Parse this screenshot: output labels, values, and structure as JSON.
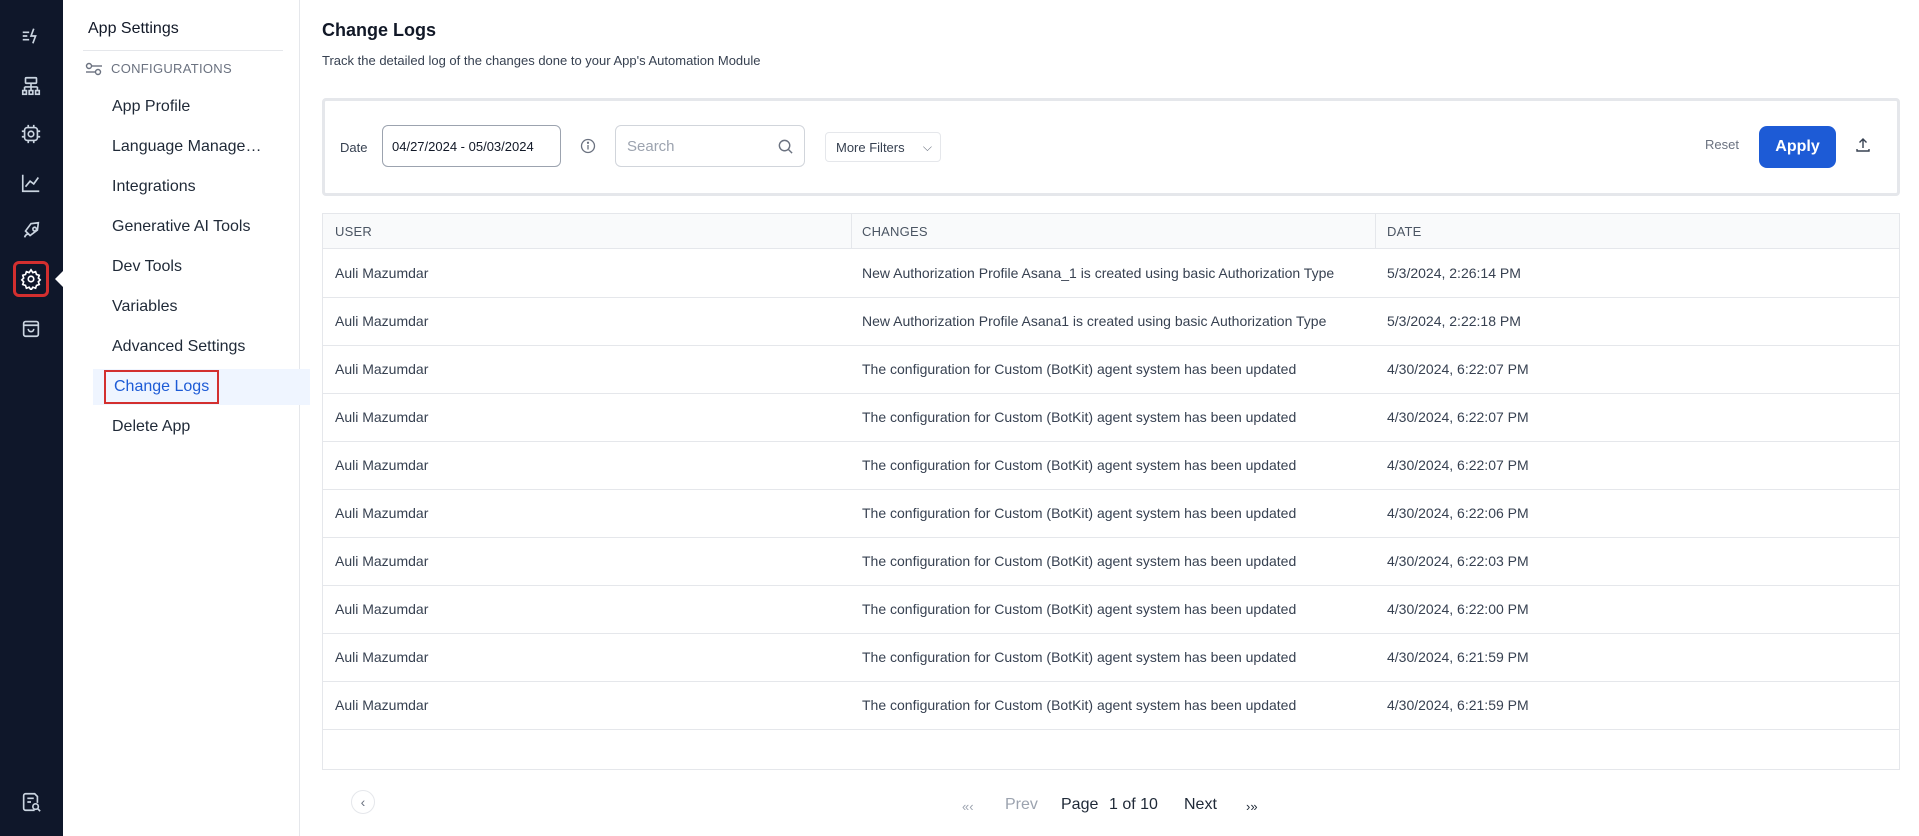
{
  "rail": {
    "icons": [
      "automation-icon",
      "flow-icon",
      "chip-icon",
      "analytics-icon",
      "rocket-icon",
      "gear-icon",
      "bag-icon",
      "help-doc-icon"
    ]
  },
  "sidebar": {
    "title": "App Settings",
    "section": "CONFIGURATIONS",
    "items": [
      {
        "label": "App Profile"
      },
      {
        "label": "Language Management"
      },
      {
        "label": "Integrations"
      },
      {
        "label": "Generative AI Tools"
      },
      {
        "label": "Dev Tools"
      },
      {
        "label": "Variables"
      },
      {
        "label": "Advanced Settings"
      },
      {
        "label": "Change Logs"
      },
      {
        "label": "Delete App"
      }
    ]
  },
  "main": {
    "title": "Change Logs",
    "subtitle": "Track the detailed log of the changes done to your App's Automation Module"
  },
  "filters": {
    "date_label": "Date",
    "date_value": "04/27/2024 - 05/03/2024",
    "search_placeholder": "Search",
    "more_filters": "More Filters",
    "reset": "Reset",
    "apply": "Apply"
  },
  "table": {
    "columns": [
      "USER",
      "CHANGES",
      "DATE"
    ],
    "rows": [
      {
        "user": "Auli Mazumdar",
        "change": "New Authorization Profile Asana_1 is created using basic Authorization Type",
        "date": "5/3/2024, 2:26:14 PM"
      },
      {
        "user": "Auli Mazumdar",
        "change": "New Authorization Profile Asana1 is created using basic Authorization Type",
        "date": "5/3/2024, 2:22:18 PM"
      },
      {
        "user": "Auli Mazumdar",
        "change": "The configuration for Custom (BotKit) agent system has been updated",
        "date": "4/30/2024, 6:22:07 PM"
      },
      {
        "user": "Auli Mazumdar",
        "change": "The configuration for Custom (BotKit) agent system has been updated",
        "date": "4/30/2024, 6:22:07 PM"
      },
      {
        "user": "Auli Mazumdar",
        "change": "The configuration for Custom (BotKit) agent system has been updated",
        "date": "4/30/2024, 6:22:07 PM"
      },
      {
        "user": "Auli Mazumdar",
        "change": "The configuration for Custom (BotKit) agent system has been updated",
        "date": "4/30/2024, 6:22:06 PM"
      },
      {
        "user": "Auli Mazumdar",
        "change": "The configuration for Custom (BotKit) agent system has been updated",
        "date": "4/30/2024, 6:22:03 PM"
      },
      {
        "user": "Auli Mazumdar",
        "change": "The configuration for Custom (BotKit) agent system has been updated",
        "date": "4/30/2024, 6:22:00 PM"
      },
      {
        "user": "Auli Mazumdar",
        "change": "The configuration for Custom (BotKit) agent system has been updated",
        "date": "4/30/2024, 6:21:59 PM"
      },
      {
        "user": "Auli Mazumdar",
        "change": "The configuration for Custom (BotKit) agent system has been updated",
        "date": "4/30/2024, 6:21:59 PM"
      }
    ]
  },
  "pagination": {
    "first": "«‹",
    "prev": "Prev",
    "page_label": "Page",
    "page_value": "1 of 10",
    "next": "Next",
    "last": "›»"
  }
}
